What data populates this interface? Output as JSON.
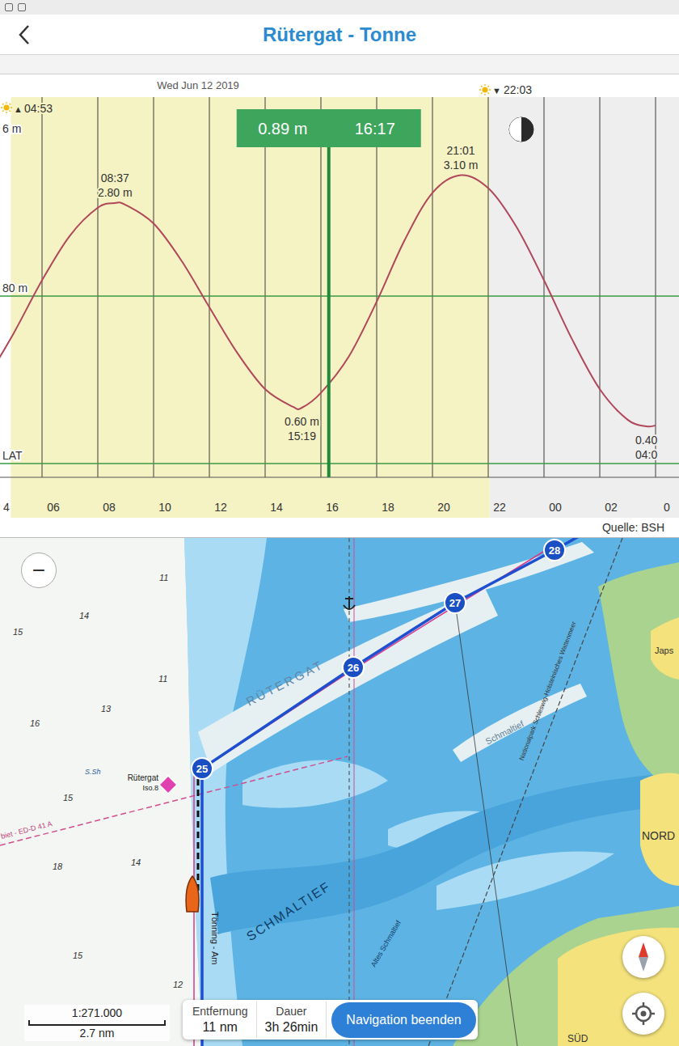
{
  "header": {
    "title": "Rütergat - Tonne"
  },
  "chart": {
    "date": "Wed Jun 12 2019",
    "sunrise": {
      "mark": "▲",
      "time": "04:53",
      "hour": 4.883
    },
    "sunset": {
      "mark": "▼",
      "time": "22:03",
      "hour": 22.05
    },
    "cursor": {
      "value": "0.89 m",
      "time": "16:17",
      "hour": 16.283
    },
    "y_labels": [
      {
        "text": "6 m"
      },
      {
        "text": "80 m",
        "value": 1.8
      },
      {
        "text": "LAT",
        "value": 0
      }
    ],
    "x_ticks": [
      "4",
      "06",
      "08",
      "10",
      "12",
      "14",
      "16",
      "18",
      "20",
      "22",
      "00",
      "02",
      "0"
    ],
    "extremes": [
      {
        "time": "08:37",
        "height": "2.80 m",
        "hour": 8.617,
        "value": 2.8,
        "kind": "high"
      },
      {
        "time": "15:19",
        "height": "0.60 m",
        "hour": 15.317,
        "value": 0.6,
        "kind": "low"
      },
      {
        "time": "21:01",
        "height": "3.10 m",
        "hour": 21.017,
        "value": 3.1,
        "kind": "high"
      },
      {
        "time": "04:0",
        "height": "0.40",
        "hour": 27.67,
        "value": 0.4,
        "kind": "low"
      }
    ],
    "series": {
      "hours": [
        4,
        5,
        6,
        7,
        8,
        8.617,
        9,
        10,
        11,
        12,
        13,
        14,
        15,
        15.317,
        16,
        17,
        18,
        19,
        20,
        21.017,
        22,
        23,
        24,
        25,
        26,
        27,
        27.67,
        28
      ],
      "values": [
        0.9,
        1.41,
        1.97,
        2.45,
        2.75,
        2.8,
        2.78,
        2.58,
        2.18,
        1.68,
        1.19,
        0.8,
        0.61,
        0.6,
        0.76,
        1.15,
        1.74,
        2.4,
        2.91,
        3.1,
        2.96,
        2.55,
        1.97,
        1.34,
        0.8,
        0.47,
        0.4,
        0.41
      ]
    },
    "source": "Quelle: BSH"
  },
  "map": {
    "zoom_out": "−",
    "waypoints": [
      {
        "label": "25"
      },
      {
        "label": "26"
      },
      {
        "label": "27"
      },
      {
        "label": "28"
      }
    ],
    "depths": [
      "11",
      "14",
      "15",
      "11",
      "13",
      "16",
      "15",
      "18",
      "14",
      "15",
      "12"
    ],
    "labels": [
      "RÜTERGAT",
      "Schmaltief",
      "SCHMALTIEF",
      "Altes Schmaltief",
      "NORD",
      "Japs",
      "SÜD",
      "Rütergat",
      "Iso.8",
      "S.Sh",
      "Tönning - Am",
      "biet - ED-D 41 A",
      "Nationalpark Schleswig-Holsteinisches Wattenmeer"
    ],
    "scale": {
      "ratio": "1:271.000",
      "distance": "2.7 nm"
    },
    "route": {
      "distance_label": "Entfernung",
      "distance": "11 nm",
      "duration_label": "Dauer",
      "duration": "3h 26min",
      "stop_button": "Navigation beenden"
    }
  }
}
